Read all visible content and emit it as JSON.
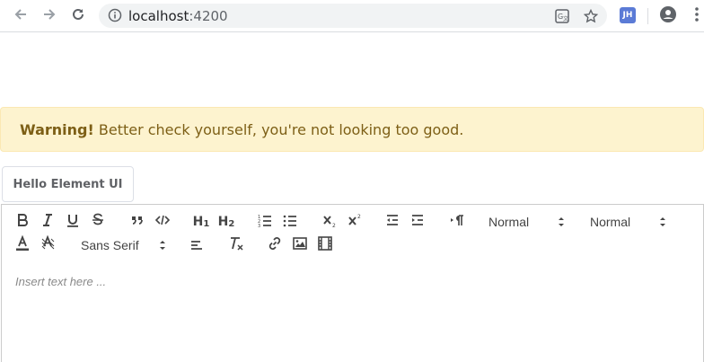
{
  "browser": {
    "url_host": "localhost",
    "url_port": ":4200",
    "extension_badge": "JH"
  },
  "alert": {
    "strong": "Warning!",
    "text": " Better check yourself, you're not looking too good."
  },
  "button": {
    "label": "Hello Element UI"
  },
  "toolbar": {
    "header1": "H",
    "header1_sub": "1",
    "header2": "H",
    "header2_sub": "2",
    "size_picker": "Normal",
    "header_picker": "Normal",
    "font_picker": "Sans Serif"
  },
  "editor": {
    "placeholder": "Insert text here ..."
  }
}
